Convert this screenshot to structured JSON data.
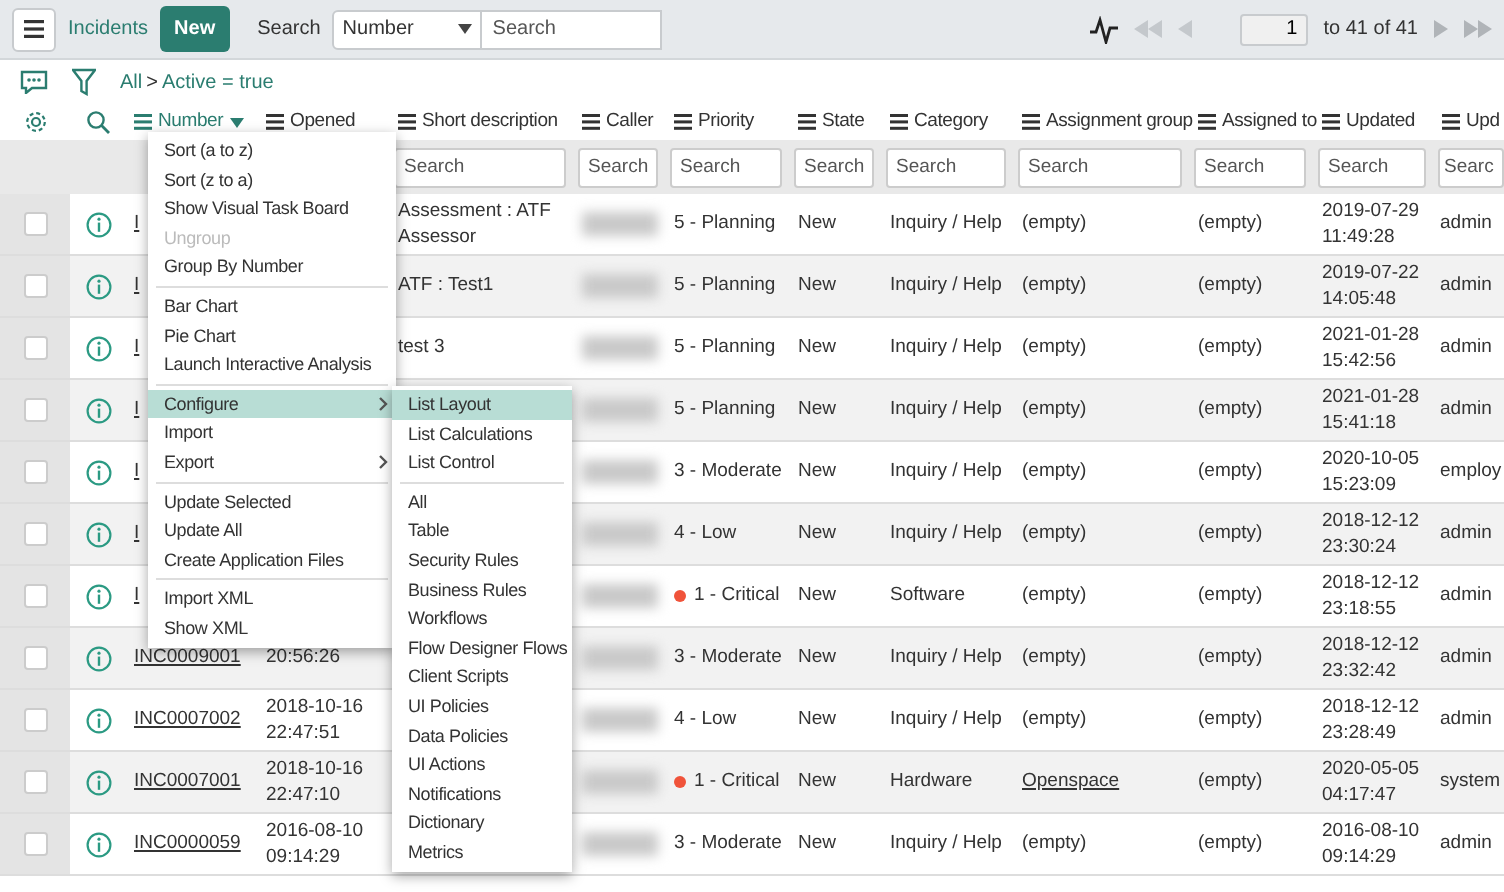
{
  "topbar": {
    "title": "Incidents",
    "new_button": "New",
    "search_label": "Search",
    "search_field": "Number",
    "search_placeholder": "Search",
    "page": "1",
    "page_range": "to 41 of 41"
  },
  "breadcrumb": {
    "items": [
      "All",
      "Active = true"
    ],
    "separator": ">"
  },
  "columns": [
    {
      "label": "Number",
      "active": true
    },
    {
      "label": "Opened",
      "active": false
    },
    {
      "label": "Short description",
      "active": false,
      "search_placeholder": "Search"
    },
    {
      "label": "Caller",
      "active": false,
      "search_placeholder": "Search"
    },
    {
      "label": "Priority",
      "active": false,
      "search_placeholder": "Search"
    },
    {
      "label": "State",
      "active": false,
      "search_placeholder": "Search"
    },
    {
      "label": "Category",
      "active": false,
      "search_placeholder": "Search"
    },
    {
      "label": "Assignment group",
      "active": false,
      "search_placeholder": "Search"
    },
    {
      "label": "Assigned to",
      "active": false,
      "search_placeholder": "Search"
    },
    {
      "label": "Updated",
      "active": false,
      "search_placeholder": "Search"
    },
    {
      "label": "Upd",
      "active": false,
      "search_placeholder": "Searc"
    }
  ],
  "rows": [
    {
      "checked": false,
      "number": "I",
      "short_description": "Assessment : ATF Assessor",
      "priority": "5 - Planning",
      "critical": false,
      "state": "New",
      "category": "Inquiry / Help",
      "assignment_group": "(empty)",
      "group_link": false,
      "assigned_to": "(empty)",
      "updated": "2019-07-29 11:49:28",
      "updated_by": "admin"
    },
    {
      "checked": false,
      "number": "I",
      "short_description": "ATF : Test1",
      "priority": "5 - Planning",
      "critical": false,
      "state": "New",
      "category": "Inquiry / Help",
      "assignment_group": "(empty)",
      "group_link": false,
      "assigned_to": "(empty)",
      "updated": "2019-07-22 14:05:48",
      "updated_by": "admin"
    },
    {
      "checked": false,
      "number": "I",
      "short_description": "test 3",
      "priority": "5 - Planning",
      "critical": false,
      "state": "New",
      "category": "Inquiry / Help",
      "assignment_group": "(empty)",
      "group_link": false,
      "assigned_to": "(empty)",
      "updated": "2021-01-28 15:42:56",
      "updated_by": "admin"
    },
    {
      "checked": false,
      "number": "I",
      "priority": "5 - Planning",
      "critical": false,
      "state": "New",
      "category": "Inquiry / Help",
      "assignment_group": "(empty)",
      "group_link": false,
      "assigned_to": "(empty)",
      "updated": "2021-01-28 15:41:18",
      "updated_by": "admin"
    },
    {
      "checked": false,
      "number": "I",
      "priority": "3 - Moderate",
      "critical": false,
      "state": "New",
      "category": "Inquiry / Help",
      "assignment_group": "(empty)",
      "group_link": false,
      "assigned_to": "(empty)",
      "updated": "2020-10-05 15:23:09",
      "updated_by": "employ"
    },
    {
      "checked": false,
      "number": "I",
      "priority": "4 - Low",
      "critical": false,
      "state": "New",
      "category": "Inquiry / Help",
      "assignment_group": "(empty)",
      "group_link": false,
      "assigned_to": "(empty)",
      "updated": "2018-12-12 23:30:24",
      "updated_by": "admin"
    },
    {
      "checked": false,
      "number": "I",
      "priority": "1 - Critical",
      "critical": true,
      "state": "New",
      "category": "Software",
      "assignment_group": "(empty)",
      "group_link": false,
      "assigned_to": "(empty)",
      "updated": "2018-12-12 23:18:55",
      "updated_by": "admin"
    },
    {
      "checked": false,
      "number": "INC0009001",
      "opened": "20:56:26",
      "priority": "3 - Moderate",
      "critical": false,
      "state": "New",
      "category": "Inquiry / Help",
      "assignment_group": "(empty)",
      "group_link": false,
      "assigned_to": "(empty)",
      "updated": "2018-12-12 23:32:42",
      "updated_by": "admin"
    },
    {
      "checked": false,
      "number": "INC0007002",
      "opened": "2018-10-16 22:47:51",
      "priority": "4 - Low",
      "critical": false,
      "state": "New",
      "category": "Inquiry / Help",
      "assignment_group": "(empty)",
      "group_link": false,
      "assigned_to": "(empty)",
      "updated": "2018-12-12 23:28:49",
      "updated_by": "admin"
    },
    {
      "checked": false,
      "number": "INC0007001",
      "opened": "2018-10-16 22:47:10",
      "priority": "1 - Critical",
      "critical": true,
      "state": "New",
      "category": "Hardware",
      "assignment_group": "Openspace",
      "group_link": true,
      "assigned_to": "(empty)",
      "updated": "2020-05-05 04:17:47",
      "updated_by": "system"
    },
    {
      "checked": false,
      "number": "INC0000059",
      "opened": "2016-08-10 09:14:29",
      "priority": "3 - Moderate",
      "critical": false,
      "state": "New",
      "category": "Inquiry / Help",
      "assignment_group": "(empty)",
      "group_link": false,
      "assigned_to": "(empty)",
      "updated": "2016-08-10 09:14:29",
      "updated_by": "admin"
    }
  ],
  "context_menu": {
    "groups": [
      [
        {
          "label": "Sort (a to z)",
          "disabled": false,
          "selected": false,
          "submenu": false
        },
        {
          "label": "Sort (z to a)",
          "disabled": false,
          "selected": false,
          "submenu": false
        },
        {
          "label": "Show Visual Task Board",
          "disabled": false,
          "selected": false,
          "submenu": false
        },
        {
          "label": "Ungroup",
          "disabled": true,
          "selected": false,
          "submenu": false
        },
        {
          "label": "Group By Number",
          "disabled": false,
          "selected": false,
          "submenu": false
        }
      ],
      [
        {
          "label": "Bar Chart",
          "disabled": false,
          "selected": false,
          "submenu": false
        },
        {
          "label": "Pie Chart",
          "disabled": false,
          "selected": false,
          "submenu": false
        },
        {
          "label": "Launch Interactive Analysis",
          "disabled": false,
          "selected": false,
          "submenu": false
        }
      ],
      [
        {
          "label": "Configure",
          "disabled": false,
          "selected": true,
          "submenu": true
        },
        {
          "label": "Import",
          "disabled": false,
          "selected": false,
          "submenu": false
        },
        {
          "label": "Export",
          "disabled": false,
          "selected": false,
          "submenu": true
        }
      ],
      [
        {
          "label": "Update Selected",
          "disabled": false,
          "selected": false,
          "submenu": false
        },
        {
          "label": "Update All",
          "disabled": false,
          "selected": false,
          "submenu": false
        },
        {
          "label": "Create Application Files",
          "disabled": false,
          "selected": false,
          "submenu": false
        }
      ],
      [
        {
          "label": "Import XML",
          "disabled": false,
          "selected": false,
          "submenu": false
        },
        {
          "label": "Show XML",
          "disabled": false,
          "selected": false,
          "submenu": false
        }
      ]
    ]
  },
  "submenu": {
    "groups": [
      [
        {
          "label": "List Layout",
          "selected": true
        },
        {
          "label": "List Calculations",
          "selected": false
        },
        {
          "label": "List Control",
          "selected": false
        }
      ],
      [
        {
          "label": "All",
          "selected": false
        },
        {
          "label": "Table",
          "selected": false
        },
        {
          "label": "Security Rules",
          "selected": false
        },
        {
          "label": "Business Rules",
          "selected": false
        },
        {
          "label": "Workflows",
          "selected": false
        },
        {
          "label": "Flow Designer Flows",
          "selected": false
        },
        {
          "label": "Client Scripts",
          "selected": false
        },
        {
          "label": "UI Policies",
          "selected": false
        },
        {
          "label": "Data Policies",
          "selected": false
        },
        {
          "label": "UI Actions",
          "selected": false
        },
        {
          "label": "Notifications",
          "selected": false
        },
        {
          "label": "Dictionary",
          "selected": false
        },
        {
          "label": "Metrics",
          "selected": false
        }
      ]
    ]
  }
}
